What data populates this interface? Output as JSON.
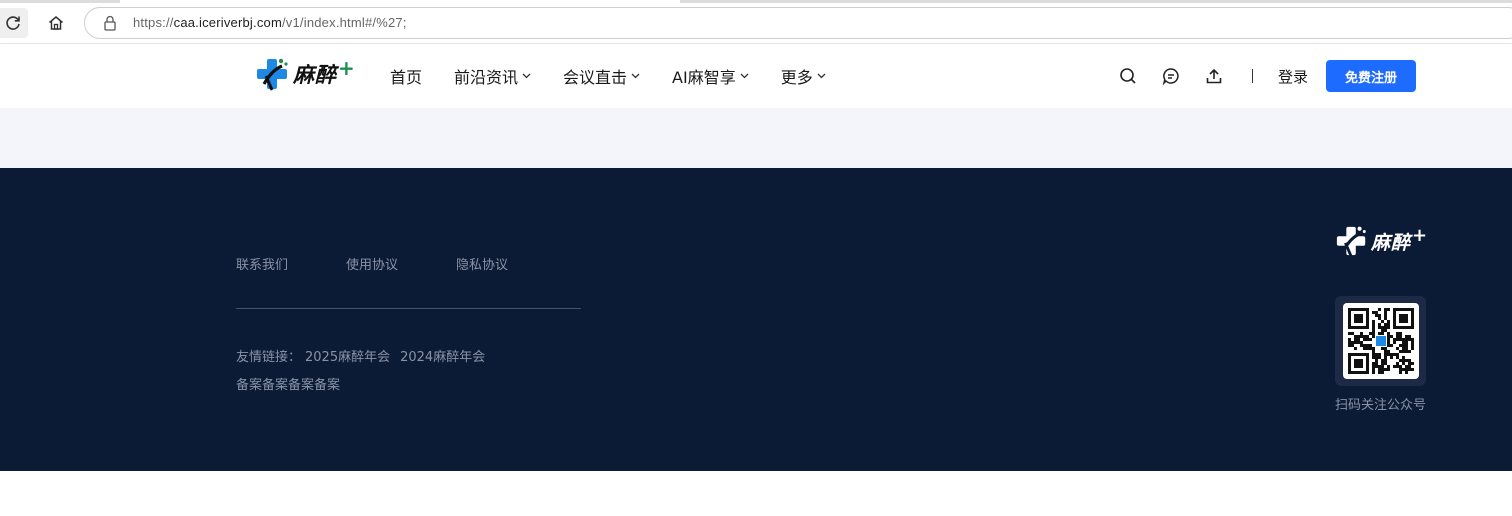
{
  "browser": {
    "url_scheme": "https://",
    "url_host": "caa.iceriverbj.com",
    "url_path": "/v1/index.html#/%27;"
  },
  "header": {
    "logo_text": "麻醉",
    "logo_plus": "+",
    "nav": [
      {
        "label": "首页",
        "dropdown": false
      },
      {
        "label": "前沿资讯",
        "dropdown": true
      },
      {
        "label": "会议直击",
        "dropdown": true
      },
      {
        "label": "AI麻智享",
        "dropdown": true
      },
      {
        "label": "更多",
        "dropdown": true
      }
    ],
    "icons": [
      "search-icon",
      "message-icon",
      "upload-icon"
    ],
    "login_label": "登录",
    "register_label": "免费注册"
  },
  "footer": {
    "links": [
      "联系我们",
      "使用协议",
      "隐私协议"
    ],
    "friend_label": "友情链接：",
    "friend_links": [
      "2025麻醉年会",
      "2024麻醉年会"
    ],
    "beian": "备案备案备案备案",
    "logo_text": "麻醉",
    "logo_plus": "+",
    "qr_caption": "扫码关注公众号"
  },
  "colors": {
    "accent": "#1e6bff",
    "footer_bg": "#0b1a35",
    "band_bg": "#f3f5fa",
    "logo_blue": "#1e88e5",
    "logo_green": "#1f8f4f"
  }
}
